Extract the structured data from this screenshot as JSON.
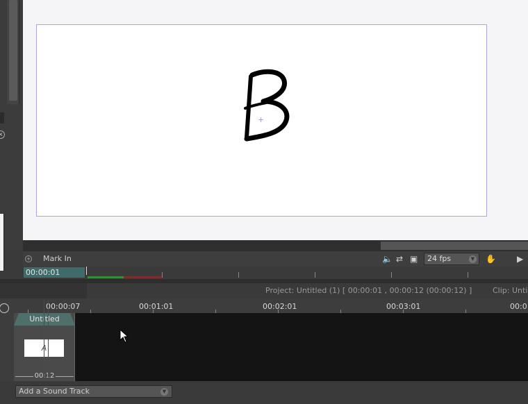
{
  "canvas": {
    "drawing_letter": "B",
    "center_marker": "+"
  },
  "playback": {
    "mark_in_label": "Mark In",
    "fps": "24 fps",
    "current_timecode": "00:00:01"
  },
  "info": {
    "project": "Project: Untitled (1) [ 00:00:01 , 00:00:12  (00:00:12) ]",
    "clip": "Clip: Unti"
  },
  "ruler": {
    "labels": [
      "00:00:07",
      "00:01:01",
      "00:02:01",
      "00:03:01",
      "00:0"
    ]
  },
  "clip": {
    "title": "Untitled",
    "thumb_text": "A",
    "duration": "00:12"
  },
  "sound": {
    "add_label": "Add a Sound Track"
  },
  "icons": {
    "close": "close-icon",
    "speaker": "speaker-icon",
    "loop": "loop-icon",
    "frame": "frame-icon",
    "hand": "hand-icon",
    "play": "play-icon",
    "dropdown": "chevron-down-icon"
  },
  "colors": {
    "timecode_bg": "#3f6b6b",
    "clip_header": "#4f6f6a",
    "playhead": "#b0202a",
    "frame_border": "#a9a6e8"
  }
}
